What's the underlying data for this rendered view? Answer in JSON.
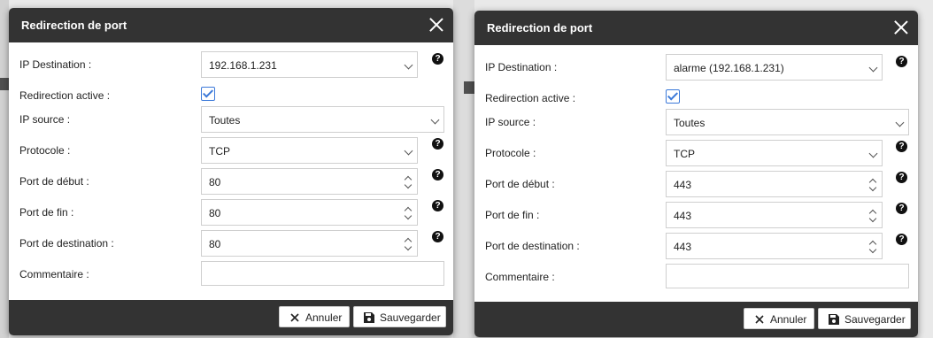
{
  "dialogs": [
    {
      "title": "Redirection de port",
      "fields": {
        "ip_destination": {
          "label": "IP Destination :",
          "value": "192.168.1.231"
        },
        "redirection_active": {
          "label": "Redirection active :",
          "checked": true
        },
        "ip_source": {
          "label": "IP source :",
          "value": "Toutes"
        },
        "protocole": {
          "label": "Protocole :",
          "value": "TCP"
        },
        "port_debut": {
          "label": "Port de début :",
          "value": "80"
        },
        "port_fin": {
          "label": "Port de fin :",
          "value": "80"
        },
        "port_destination": {
          "label": "Port de destination :",
          "value": "80"
        },
        "commentaire": {
          "label": "Commentaire :",
          "value": ""
        }
      },
      "help_glyph": "?",
      "buttons": {
        "cancel": "Annuler",
        "save": "Sauvegarder"
      }
    },
    {
      "title": "Redirection de port",
      "fields": {
        "ip_destination": {
          "label": "IP Destination :",
          "value": "alarme (192.168.1.231)"
        },
        "redirection_active": {
          "label": "Redirection active :",
          "checked": true
        },
        "ip_source": {
          "label": "IP source :",
          "value": "Toutes"
        },
        "protocole": {
          "label": "Protocole :",
          "value": "TCP"
        },
        "port_debut": {
          "label": "Port de début :",
          "value": "443"
        },
        "port_fin": {
          "label": "Port de fin :",
          "value": "443"
        },
        "port_destination": {
          "label": "Port de destination :",
          "value": "443"
        },
        "commentaire": {
          "label": "Commentaire :",
          "value": ""
        }
      },
      "help_glyph": "?",
      "buttons": {
        "cancel": "Annuler",
        "save": "Sauvegarder"
      }
    }
  ],
  "colors": {
    "header": "#333333",
    "accent": "#3b79d9"
  }
}
